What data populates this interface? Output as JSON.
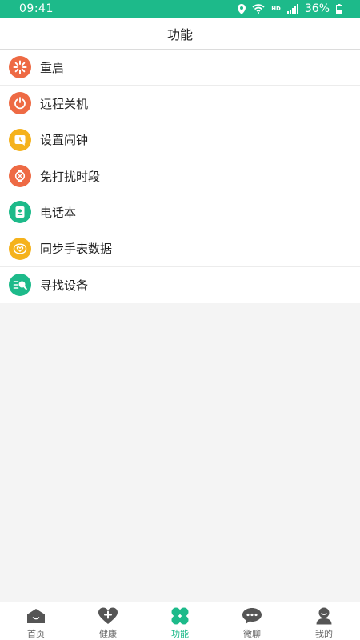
{
  "status_bar": {
    "time": "09:41",
    "network": "HD",
    "battery": "36%"
  },
  "header": {
    "title": "功能"
  },
  "menu": {
    "items": [
      {
        "label": "重启",
        "icon": "restart-icon",
        "color": "#ee6a44"
      },
      {
        "label": "远程关机",
        "icon": "power-icon",
        "color": "#ee6a44"
      },
      {
        "label": "设置闹钟",
        "icon": "alarm-icon",
        "color": "#f5b21c"
      },
      {
        "label": "免打扰时段",
        "icon": "do-not-disturb-icon",
        "color": "#ee6a44"
      },
      {
        "label": "电话本",
        "icon": "phonebook-icon",
        "color": "#1dba8a"
      },
      {
        "label": "同步手表数据",
        "icon": "sync-icon",
        "color": "#f5b21c"
      },
      {
        "label": "寻找设备",
        "icon": "find-device-icon",
        "color": "#1dba8a"
      }
    ]
  },
  "tabs": {
    "items": [
      {
        "label": "首页",
        "icon": "home-icon"
      },
      {
        "label": "健康",
        "icon": "health-icon"
      },
      {
        "label": "功能",
        "icon": "function-icon",
        "active": true
      },
      {
        "label": "微聊",
        "icon": "chat-icon"
      },
      {
        "label": "我的",
        "icon": "profile-icon"
      }
    ]
  },
  "colors": {
    "accent": "#1dba8a",
    "orange": "#ee6a44",
    "yellow": "#f5b21c",
    "inactive": "#666666"
  }
}
